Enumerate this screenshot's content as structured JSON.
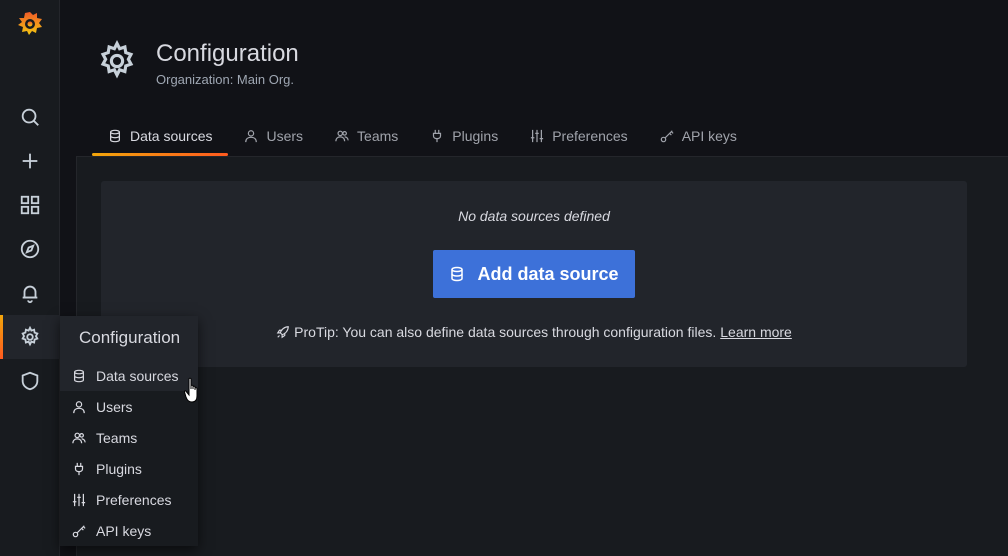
{
  "sidebar": {
    "logo_icon": "grafana-logo-icon",
    "items": [
      {
        "name": "search",
        "icon": "search-icon"
      },
      {
        "name": "create",
        "icon": "plus-icon"
      },
      {
        "name": "dashboards",
        "icon": "grid-icon"
      },
      {
        "name": "explore",
        "icon": "compass-icon"
      },
      {
        "name": "alerting",
        "icon": "bell-icon"
      },
      {
        "name": "configuration",
        "icon": "gear-icon",
        "active": true
      },
      {
        "name": "server-admin",
        "icon": "shield-icon"
      }
    ]
  },
  "header": {
    "title": "Configuration",
    "subtitle": "Organization: Main Org.",
    "tabs": [
      {
        "label": "Data sources",
        "icon": "database-icon",
        "active": true
      },
      {
        "label": "Users",
        "icon": "user-icon"
      },
      {
        "label": "Teams",
        "icon": "users-icon"
      },
      {
        "label": "Plugins",
        "icon": "plug-icon"
      },
      {
        "label": "Preferences",
        "icon": "sliders-icon"
      },
      {
        "label": "API keys",
        "icon": "key-icon"
      }
    ]
  },
  "main": {
    "empty_title": "No data sources defined",
    "add_button_label": "Add data source",
    "protip_text": "ProTip: You can also define data sources through configuration files.",
    "protip_link": "Learn more"
  },
  "dropdown": {
    "header": "Configuration",
    "items": [
      {
        "label": "Data sources",
        "icon": "database-icon"
      },
      {
        "label": "Users",
        "icon": "user-icon"
      },
      {
        "label": "Teams",
        "icon": "users-icon"
      },
      {
        "label": "Plugins",
        "icon": "plug-icon"
      },
      {
        "label": "Preferences",
        "icon": "sliders-icon"
      },
      {
        "label": "API keys",
        "icon": "key-icon"
      }
    ]
  },
  "colors": {
    "accent_start": "#f2a60b",
    "accent_end": "#ff5a1f",
    "primary_button": "#3d71d9",
    "background": "#111217",
    "panel": "#181b1f",
    "card": "#22252b"
  }
}
